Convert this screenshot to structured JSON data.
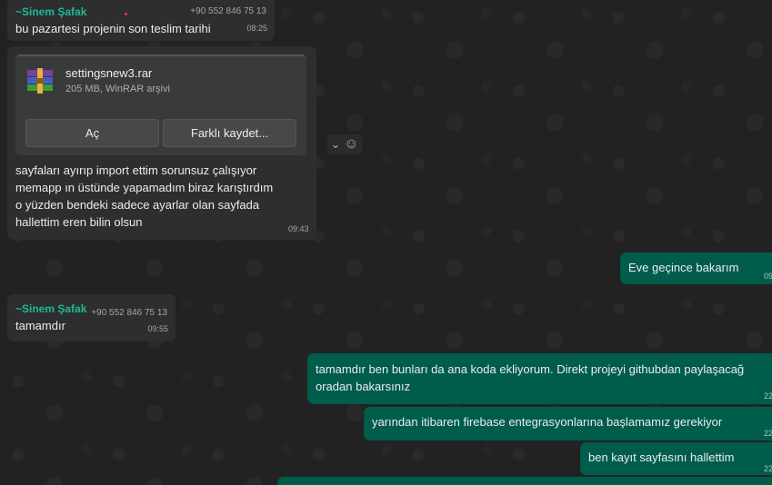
{
  "messages": [
    {
      "sender": "~Sinem Şafak",
      "phone": "+90 552 846 75 13",
      "text": "bu pazartesi projenin son teslim tarihi",
      "time": "08:25"
    },
    {
      "file": {
        "name": "settingsnew3.rar",
        "meta": "205 MB, WinRAR arşivi",
        "open_label": "Aç",
        "save_as_label": "Farklı kaydet..."
      },
      "lines": [
        "sayfaları ayırıp import ettim sorunsuz çalışıyor",
        "memapp ın üstünde yapamadım biraz karıştırdım",
        "o yüzden bendeki sadece ayarlar olan sayfada",
        "hallettim eren bilin olsun"
      ],
      "time": "09:43"
    },
    {
      "text": "Eve geçince bakarım",
      "time": "09"
    },
    {
      "sender": "~Sinem Şafak",
      "phone": "+90 552 846 75 13",
      "text": "tamamdır",
      "time": "09:55"
    },
    {
      "lines": [
        "tamamdır ben bunları da ana koda ekliyorum. Direkt projeyi githubdan paylaşacağ",
        "oradan bakarsınız"
      ],
      "time": "22"
    },
    {
      "text": "yarından itibaren firebase entegrasyonlarına başlamamız gerekiyor",
      "time": "22"
    },
    {
      "text": "ben kayıt sayfasını hallettim",
      "time": "22"
    }
  ],
  "reaction": {
    "chevron": "⌄",
    "emoji": "☺"
  },
  "colors": {
    "incoming": "#2e2e2e",
    "outgoing": "#005c4b",
    "sender": "#1fb893",
    "background": "#222222"
  }
}
